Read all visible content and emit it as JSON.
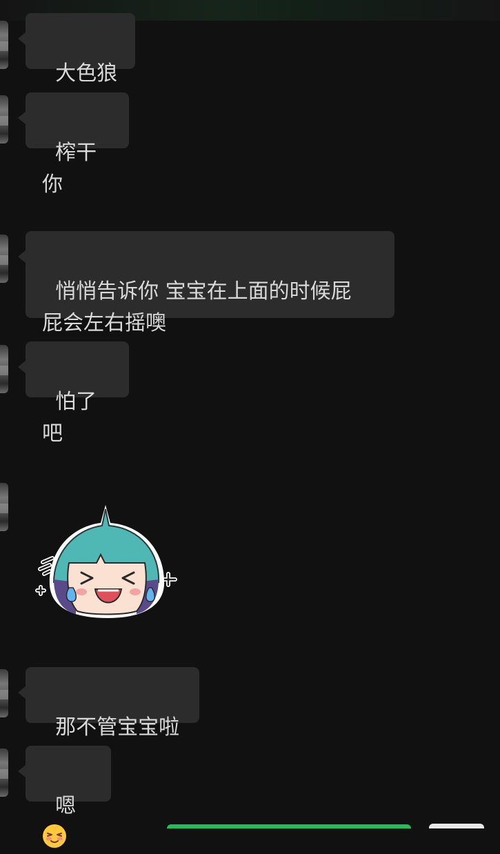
{
  "chat": {
    "messages": [
      {
        "type": "text",
        "text": "大色狼"
      },
      {
        "type": "text",
        "text": "榨干你"
      },
      {
        "type": "text",
        "text": "悄悄告诉你 宝宝在上面的时候屁\n屁会左右摇噢"
      },
      {
        "type": "text",
        "text": "怕了吧"
      },
      {
        "type": "sticker",
        "icon": "laughing-crying-girl-sticker"
      },
      {
        "type": "text",
        "text": "那不管宝宝啦"
      },
      {
        "type": "text",
        "text": "嗯",
        "emoji": "smiling-blushing-emoji"
      }
    ]
  },
  "colors": {
    "background": "#111111",
    "bubble": "#2c2c2c",
    "accent_green": "#1fbf5b"
  }
}
